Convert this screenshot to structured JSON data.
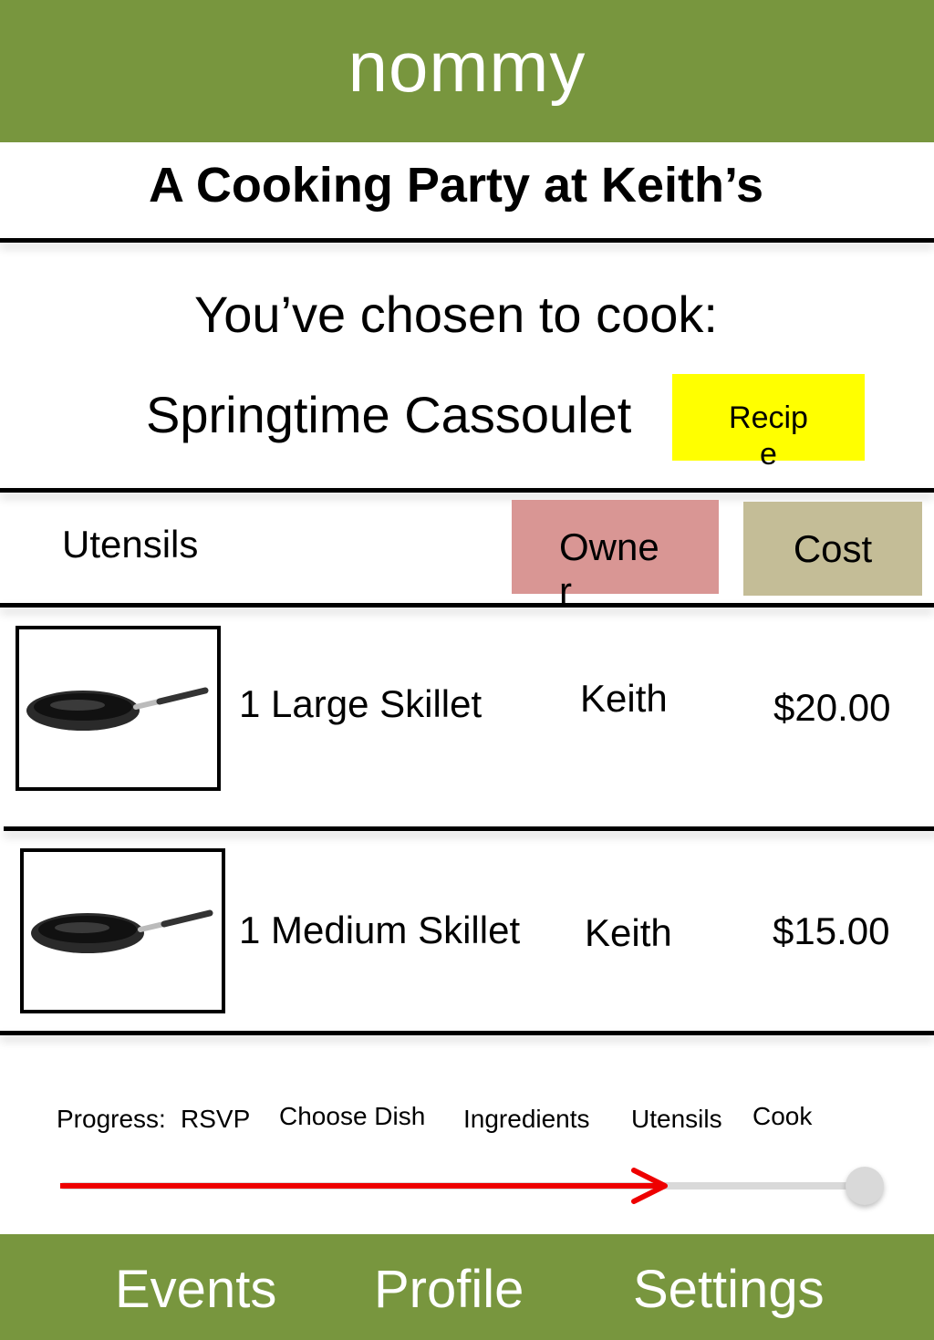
{
  "header": {
    "app_title": "nommy"
  },
  "event": {
    "title": "A Cooking Party at Keith’s"
  },
  "dish": {
    "chosen_label": "You’ve chosen to cook:",
    "name": "Springtime Cassoulet",
    "recipe_button": "Recipe"
  },
  "table": {
    "columns": {
      "utensils": "Utensils",
      "owner": "Owner",
      "cost": "Cost"
    },
    "rows": [
      {
        "name": "1 Large Skillet",
        "owner": "Keith",
        "cost": "$20.00",
        "image_icon": "skillet-icon"
      },
      {
        "name": "1 Medium Skillet",
        "owner": "Keith",
        "cost": "$15.00",
        "image_icon": "skillet-icon"
      }
    ]
  },
  "progress": {
    "label": "Progress:",
    "steps": [
      "RSVP",
      "Choose Dish",
      "Ingredients",
      "Utensils",
      "Cook"
    ],
    "current_step": "Utensils",
    "fraction": 0.75,
    "fill_color": "#ee0000"
  },
  "nav": {
    "events": "Events",
    "profile": "Profile",
    "settings": "Settings"
  },
  "colors": {
    "brand_green": "#78963e",
    "recipe_yellow": "#ffff00",
    "owner_pink": "#d99694",
    "cost_tan": "#c4bd97"
  }
}
